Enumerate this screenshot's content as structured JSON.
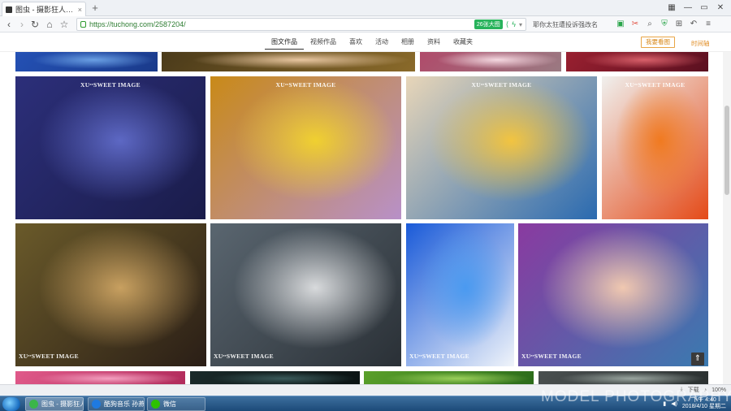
{
  "browser": {
    "tab_title": "图虫 - 摄影狂人小宣宣 - 图虫网",
    "url": "https://tuchong.com/2587204/",
    "ext_badge": "26张大图",
    "search_hint": "耶你太狂遭投诉强改名"
  },
  "site": {
    "tabs": [
      {
        "label": "图文作品",
        "active": true
      },
      {
        "label": "视频作品",
        "active": false
      },
      {
        "label": "喜欢",
        "active": false
      },
      {
        "label": "活动",
        "active": false
      },
      {
        "label": "相册",
        "active": false
      },
      {
        "label": "资料",
        "active": false
      },
      {
        "label": "收藏夹",
        "active": false
      }
    ],
    "follow_label": "我要看图",
    "timeline_label": "时间轴"
  },
  "photos": {
    "watermark": "XUᵉᵉSWEET IMAGE",
    "items": [
      {
        "colors": [
          "#2451b5",
          "#6aa0e4",
          "#1a3a8a"
        ]
      },
      {
        "colors": [
          "#4a3a1a",
          "#e8c6a0",
          "#8a6a2a"
        ]
      },
      {
        "colors": [
          "#b04a6a",
          "#f4d8e0",
          "#9a7a82"
        ]
      },
      {
        "colors": [
          "#9a2030",
          "#d8606a",
          "#5a1020"
        ]
      },
      {
        "colors": [
          "#2c2f7a",
          "#5d68c4",
          "#1a1c4a"
        ]
      },
      {
        "colors": [
          "#c98a18",
          "#f0d030",
          "#b890c8"
        ]
      },
      {
        "colors": [
          "#e8d6b8",
          "#f2c440",
          "#2a6ab0"
        ]
      },
      {
        "colors": [
          "#f0f0ee",
          "#f07a20",
          "#e44a18"
        ]
      },
      {
        "colors": [
          "#6a5a2a",
          "#c8a060",
          "#2a1e16"
        ]
      },
      {
        "colors": [
          "#5a6670",
          "#d8dadc",
          "#2a3036"
        ]
      },
      {
        "colors": [
          "#1a5ad8",
          "#4a9af0",
          "#f0f4fa"
        ]
      },
      {
        "colors": [
          "#8a3aa0",
          "#f0c8b0",
          "#3a7ab0"
        ]
      },
      {
        "colors": [
          "#e05a8a",
          "#f4a0c0",
          "#b02a5a"
        ]
      },
      {
        "colors": [
          "#1a2a2a",
          "#3a5a5a",
          "#0a1212"
        ]
      },
      {
        "colors": [
          "#5aa02a",
          "#9ad05a",
          "#2a6a1a"
        ]
      },
      {
        "colors": [
          "#4a5050",
          "#9aa6a0",
          "#2a3030"
        ]
      }
    ]
  },
  "statusbar": {
    "download_label": "下载",
    "zoom": "100%"
  },
  "taskbar": {
    "tasks": [
      {
        "label": "图虫 - 摄影狂人...",
        "color": "#3bb54a"
      },
      {
        "label": "酷狗音乐 孙燕...",
        "color": "#1f7ae0"
      },
      {
        "label": "微信",
        "color": "#2dc100"
      }
    ],
    "time": "下午 4:40",
    "date": "2018/4/10 星期二"
  },
  "page_watermark": "MODEL PHOTOGRAPHY"
}
